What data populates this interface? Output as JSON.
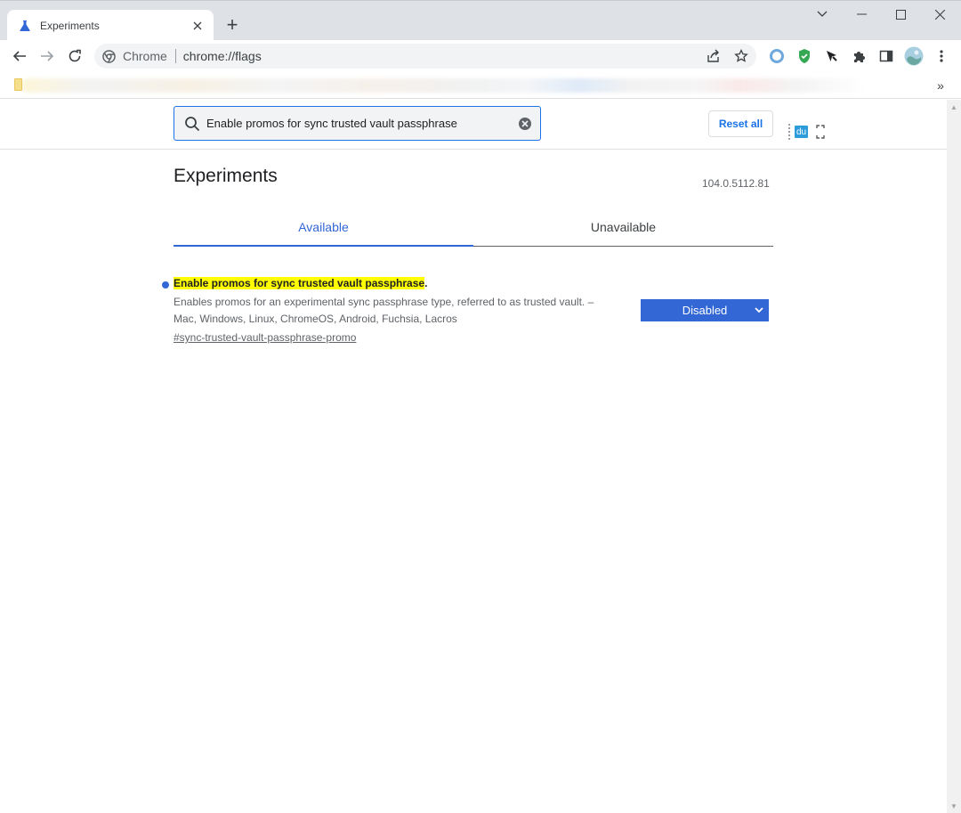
{
  "browser": {
    "tab_title": "Experiments",
    "address_chip": "Chrome",
    "url": "chrome://flags",
    "new_tab_label": "+",
    "bookmarks_more": "»"
  },
  "page": {
    "search_value": "Enable promos for sync trusted vault passphrase",
    "reset_label": "Reset all",
    "title": "Experiments",
    "version": "104.0.5112.81",
    "tabs": [
      {
        "label": "Available",
        "active": true
      },
      {
        "label": "Unavailable",
        "active": false
      }
    ],
    "flag": {
      "name": "Enable promos for sync trusted vault passphrase",
      "name_suffix": ".",
      "description": "Enables promos for an experimental sync passphrase type, referred to as trusted vault. – Mac, Windows, Linux, ChromeOS, Android, Fuchsia, Lacros",
      "link": "#sync-trusted-vault-passphrase-promo",
      "state": "Disabled"
    },
    "extension_badge": "du"
  },
  "colors": {
    "accent": "#3367d6",
    "search_highlight": "#ffff00",
    "tab_strip": "#dee1e6"
  }
}
